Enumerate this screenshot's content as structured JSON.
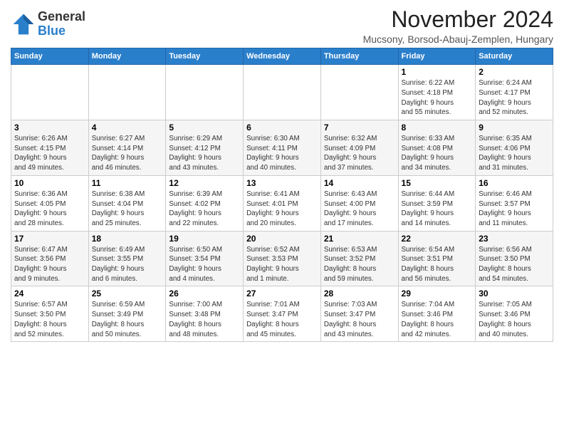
{
  "logo": {
    "general": "General",
    "blue": "Blue"
  },
  "title": "November 2024",
  "location": "Mucsony, Borsod-Abauj-Zemplen, Hungary",
  "days_of_week": [
    "Sunday",
    "Monday",
    "Tuesday",
    "Wednesday",
    "Thursday",
    "Friday",
    "Saturday"
  ],
  "weeks": [
    [
      {
        "day": "",
        "info": ""
      },
      {
        "day": "",
        "info": ""
      },
      {
        "day": "",
        "info": ""
      },
      {
        "day": "",
        "info": ""
      },
      {
        "day": "",
        "info": ""
      },
      {
        "day": "1",
        "info": "Sunrise: 6:22 AM\nSunset: 4:18 PM\nDaylight: 9 hours\nand 55 minutes."
      },
      {
        "day": "2",
        "info": "Sunrise: 6:24 AM\nSunset: 4:17 PM\nDaylight: 9 hours\nand 52 minutes."
      }
    ],
    [
      {
        "day": "3",
        "info": "Sunrise: 6:26 AM\nSunset: 4:15 PM\nDaylight: 9 hours\nand 49 minutes."
      },
      {
        "day": "4",
        "info": "Sunrise: 6:27 AM\nSunset: 4:14 PM\nDaylight: 9 hours\nand 46 minutes."
      },
      {
        "day": "5",
        "info": "Sunrise: 6:29 AM\nSunset: 4:12 PM\nDaylight: 9 hours\nand 43 minutes."
      },
      {
        "day": "6",
        "info": "Sunrise: 6:30 AM\nSunset: 4:11 PM\nDaylight: 9 hours\nand 40 minutes."
      },
      {
        "day": "7",
        "info": "Sunrise: 6:32 AM\nSunset: 4:09 PM\nDaylight: 9 hours\nand 37 minutes."
      },
      {
        "day": "8",
        "info": "Sunrise: 6:33 AM\nSunset: 4:08 PM\nDaylight: 9 hours\nand 34 minutes."
      },
      {
        "day": "9",
        "info": "Sunrise: 6:35 AM\nSunset: 4:06 PM\nDaylight: 9 hours\nand 31 minutes."
      }
    ],
    [
      {
        "day": "10",
        "info": "Sunrise: 6:36 AM\nSunset: 4:05 PM\nDaylight: 9 hours\nand 28 minutes."
      },
      {
        "day": "11",
        "info": "Sunrise: 6:38 AM\nSunset: 4:04 PM\nDaylight: 9 hours\nand 25 minutes."
      },
      {
        "day": "12",
        "info": "Sunrise: 6:39 AM\nSunset: 4:02 PM\nDaylight: 9 hours\nand 22 minutes."
      },
      {
        "day": "13",
        "info": "Sunrise: 6:41 AM\nSunset: 4:01 PM\nDaylight: 9 hours\nand 20 minutes."
      },
      {
        "day": "14",
        "info": "Sunrise: 6:43 AM\nSunset: 4:00 PM\nDaylight: 9 hours\nand 17 minutes."
      },
      {
        "day": "15",
        "info": "Sunrise: 6:44 AM\nSunset: 3:59 PM\nDaylight: 9 hours\nand 14 minutes."
      },
      {
        "day": "16",
        "info": "Sunrise: 6:46 AM\nSunset: 3:57 PM\nDaylight: 9 hours\nand 11 minutes."
      }
    ],
    [
      {
        "day": "17",
        "info": "Sunrise: 6:47 AM\nSunset: 3:56 PM\nDaylight: 9 hours\nand 9 minutes."
      },
      {
        "day": "18",
        "info": "Sunrise: 6:49 AM\nSunset: 3:55 PM\nDaylight: 9 hours\nand 6 minutes."
      },
      {
        "day": "19",
        "info": "Sunrise: 6:50 AM\nSunset: 3:54 PM\nDaylight: 9 hours\nand 4 minutes."
      },
      {
        "day": "20",
        "info": "Sunrise: 6:52 AM\nSunset: 3:53 PM\nDaylight: 9 hours\nand 1 minute."
      },
      {
        "day": "21",
        "info": "Sunrise: 6:53 AM\nSunset: 3:52 PM\nDaylight: 8 hours\nand 59 minutes."
      },
      {
        "day": "22",
        "info": "Sunrise: 6:54 AM\nSunset: 3:51 PM\nDaylight: 8 hours\nand 56 minutes."
      },
      {
        "day": "23",
        "info": "Sunrise: 6:56 AM\nSunset: 3:50 PM\nDaylight: 8 hours\nand 54 minutes."
      }
    ],
    [
      {
        "day": "24",
        "info": "Sunrise: 6:57 AM\nSunset: 3:50 PM\nDaylight: 8 hours\nand 52 minutes."
      },
      {
        "day": "25",
        "info": "Sunrise: 6:59 AM\nSunset: 3:49 PM\nDaylight: 8 hours\nand 50 minutes."
      },
      {
        "day": "26",
        "info": "Sunrise: 7:00 AM\nSunset: 3:48 PM\nDaylight: 8 hours\nand 48 minutes."
      },
      {
        "day": "27",
        "info": "Sunrise: 7:01 AM\nSunset: 3:47 PM\nDaylight: 8 hours\nand 45 minutes."
      },
      {
        "day": "28",
        "info": "Sunrise: 7:03 AM\nSunset: 3:47 PM\nDaylight: 8 hours\nand 43 minutes."
      },
      {
        "day": "29",
        "info": "Sunrise: 7:04 AM\nSunset: 3:46 PM\nDaylight: 8 hours\nand 42 minutes."
      },
      {
        "day": "30",
        "info": "Sunrise: 7:05 AM\nSunset: 3:46 PM\nDaylight: 8 hours\nand 40 minutes."
      }
    ]
  ]
}
